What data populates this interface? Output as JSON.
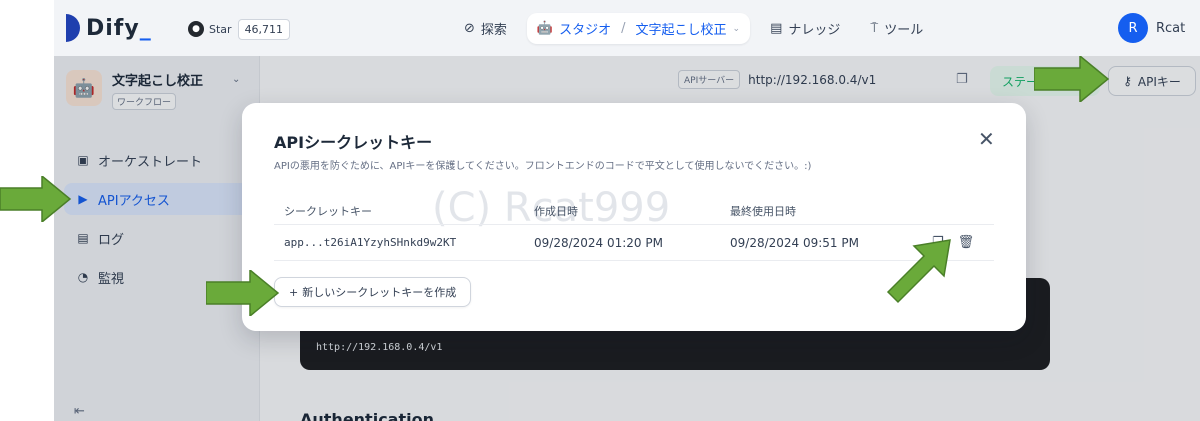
{
  "nav": {
    "logo": "Dify",
    "logo_suffix": "_",
    "github_label": "Star",
    "github_count": "46,711",
    "explore": "探索",
    "studio": "スタジオ",
    "breadcrumb_sep": "/",
    "current_app": "文字起こし校正",
    "knowledge": "ナレッジ",
    "tools": "ツール",
    "avatar_letter": "R",
    "username": "Rcat"
  },
  "sidebar": {
    "app_name": "文字起こし校正",
    "app_type": "ワークフロー",
    "items": [
      {
        "label": "オーケストレート"
      },
      {
        "label": "APIアクセス"
      },
      {
        "label": "ログ"
      },
      {
        "label": "監視"
      }
    ]
  },
  "main": {
    "api_server_pill": "APIサーバー",
    "api_server_url": "http://192.168.0.4/v1",
    "status_label": "ステータス",
    "api_key_button": "APIキー",
    "code_url": "http://192.168.0.4/v1",
    "auth_title": "Authentication"
  },
  "modal": {
    "title": "APIシークレットキー",
    "description": "APIの悪用を防ぐために、APIキーを保護してください。フロントエンドのコードで平文として使用しないでください。:)",
    "columns": [
      "シークレットキー",
      "作成日時",
      "最終使用日時"
    ],
    "rows": [
      {
        "key": "app...t26iA1YzyhSHnkd9w2KT",
        "created": "09/28/2024 01:20 PM",
        "last_used": "09/28/2024 09:51 PM"
      }
    ],
    "new_button": "新しいシークレットキーを作成",
    "watermark": "(C) Rcat999"
  },
  "colors": {
    "accent": "#155eef",
    "arrow": "#6aaa3a"
  }
}
